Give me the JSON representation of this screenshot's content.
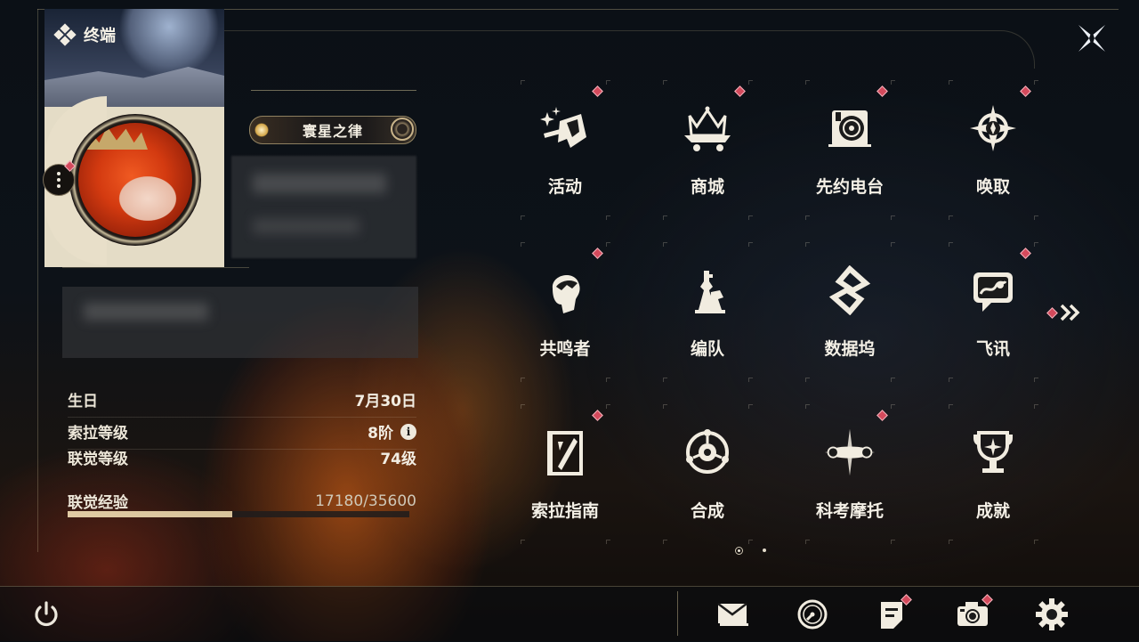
{
  "app": {
    "title": "终端"
  },
  "profile": {
    "title_plate": "寰星之律"
  },
  "stats": {
    "birthday": {
      "label": "生日",
      "value": "7月30日"
    },
    "sola_level": {
      "label": "索拉等级",
      "value": "8阶"
    },
    "union_level": {
      "label": "联觉等级",
      "value": "74级"
    },
    "union_exp": {
      "label": "联觉经验",
      "value": "17180/35600",
      "progress": 0.483
    }
  },
  "menu": {
    "items": [
      {
        "label": "活动",
        "icon": "sparkle-flag-icon",
        "badge": true
      },
      {
        "label": "商城",
        "icon": "crown-cart-icon",
        "badge": true
      },
      {
        "label": "先约电台",
        "icon": "radio-disc-icon",
        "badge": true
      },
      {
        "label": "唤取",
        "icon": "compass-star-icon",
        "badge": true
      },
      {
        "label": "共鸣者",
        "icon": "character-head-icon",
        "badge": true
      },
      {
        "label": "编队",
        "icon": "chess-pieces-icon",
        "badge": false
      },
      {
        "label": "数据坞",
        "icon": "data-dock-icon",
        "badge": false
      },
      {
        "label": "飞讯",
        "icon": "chat-bubble-icon",
        "badge": true
      },
      {
        "label": "索拉指南",
        "icon": "guide-book-icon",
        "badge": true
      },
      {
        "label": "合成",
        "icon": "synthesis-orb-icon",
        "badge": false
      },
      {
        "label": "科考摩托",
        "icon": "motorcycle-icon",
        "badge": true
      },
      {
        "label": "成就",
        "icon": "trophy-icon",
        "badge": false
      }
    ]
  },
  "bottom_bar": {
    "buttons": [
      {
        "icon": "mail-icon",
        "badge": false
      },
      {
        "icon": "clock-icon",
        "badge": false
      },
      {
        "icon": "notes-icon",
        "badge": true
      },
      {
        "icon": "camera-icon",
        "badge": true
      },
      {
        "icon": "gear-icon",
        "badge": false
      }
    ]
  },
  "colors": {
    "badge": "#d44a5c",
    "accent": "#d8c39b",
    "text": "#f4f0e6"
  }
}
